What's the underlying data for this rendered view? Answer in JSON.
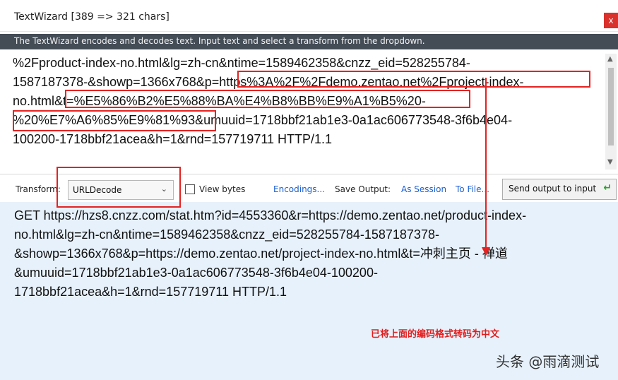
{
  "window": {
    "title": "TextWizard [389 => 321 chars]",
    "close_glyph": "x"
  },
  "description": "The TextWizard encodes and decodes text. Input text and select a transform from the dropdown.",
  "input": {
    "text": "%2Fproduct-index-no.html&lg=zh-cn&ntime=1589462358&cnzz_eid=528255784-\n1587187378-&showp=1366x768&p=https%3A%2F%2Fdemo.zentao.net%2Fproject-index-\nno.html&t=%E5%86%B2%E5%88%BA%E4%B8%BB%E9%A1%B5%20-\n%20%E7%A6%85%E9%81%93&umuuid=1718bbf21ab1e3-0a1ac606773548-3f6b4e04-\n100200-1718bbf21acea&h=1&rnd=157719711 HTTP/1.1"
  },
  "toolbar": {
    "transform_label": "Transform:",
    "transform_value": "URLDecode",
    "view_bytes_label": "View bytes",
    "view_bytes_checked": false,
    "encodings_link": "Encodings...",
    "save_output_label": "Save Output:",
    "as_session_link": "As Session",
    "to_file_link": "To File...",
    "send_output_label": "Send output to input"
  },
  "output": {
    "text": "GET https://hzs8.cnzz.com/stat.htm?id=4553360&r=https://demo.zentao.net/product-index-\nno.html&lg=zh-cn&ntime=1589462358&cnzz_eid=528255784-1587187378-\n&showp=1366x768&p=https://demo.zentao.net/project-index-no.html&t=冲刺主页 - 禅道\n&umuuid=1718bbf21ab1e3-0a1ac606773548-3f6b4e04-100200-\n1718bbf21acea&h=1&rnd=157719711 HTTP/1.1"
  },
  "annotation": {
    "note": "已将上面的编码格式转码为中文",
    "color": "#e11c1c"
  },
  "watermark": "头条 @雨滴测试",
  "icons": {
    "dropdown": "chevron-down-icon",
    "send": "send-arrow-icon",
    "close": "close-icon"
  },
  "colors": {
    "desc_bar": "#444c56",
    "output_bg": "#e7f1fb",
    "link": "#1a5fd2",
    "highlight": "#e52222"
  }
}
